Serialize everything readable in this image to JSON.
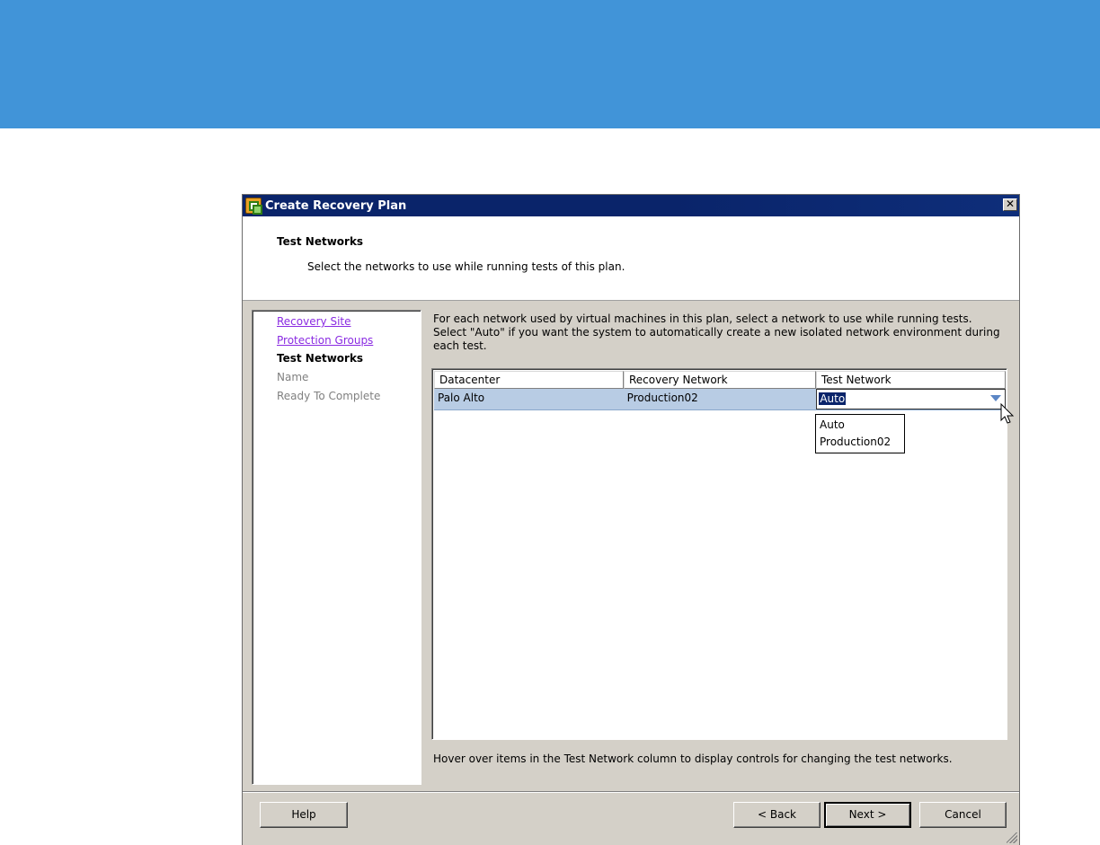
{
  "dialog": {
    "title": "Create Recovery Plan",
    "close_glyph": "✕"
  },
  "header": {
    "title": "Test Networks",
    "subtitle": "Select the networks to use while running tests of this plan."
  },
  "nav": {
    "items": [
      {
        "label": "Recovery Site",
        "state": "link"
      },
      {
        "label": "Protection Groups",
        "state": "link"
      },
      {
        "label": "Test Networks",
        "state": "current"
      },
      {
        "label": "Name",
        "state": "disabled"
      },
      {
        "label": "Ready To Complete",
        "state": "disabled"
      }
    ]
  },
  "main": {
    "instructions": "For each network used by virtual machines in this plan, select a network to use while running tests. Select \"Auto\" if you want the system to automatically create a new isolated network environment during each test.",
    "table": {
      "columns": [
        "Datacenter",
        "Recovery Network",
        "Test Network"
      ],
      "rows": [
        {
          "datacenter": "Palo Alto",
          "recovery_network": "Production02",
          "test_network": "Auto"
        }
      ]
    },
    "dropdown_options": [
      "Auto",
      "Production02"
    ],
    "hint": "Hover over items in the Test Network column to display controls for changing the test networks."
  },
  "buttons": {
    "help": "Help",
    "back": "< Back",
    "next": "Next >",
    "cancel": "Cancel"
  },
  "colors": {
    "banner": "#4194d8",
    "titlebar": "#0a246a",
    "selected_row": "#b8cce4",
    "link": "#8a2be2"
  }
}
